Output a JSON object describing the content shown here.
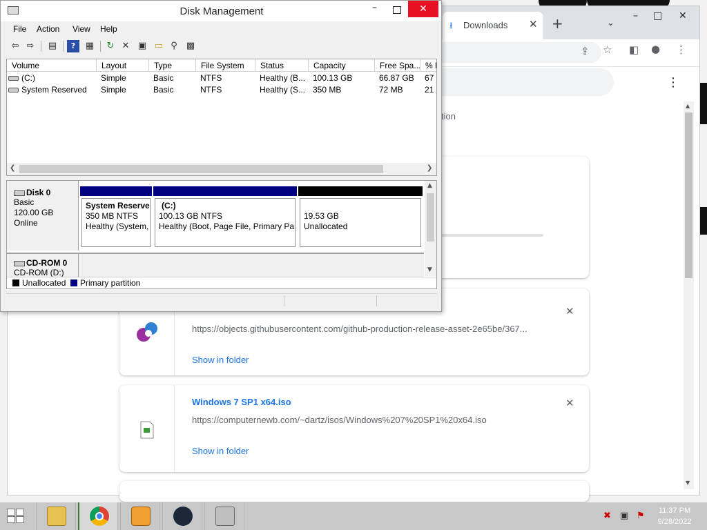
{
  "desktop": {},
  "chrome": {
    "tab": {
      "title": "Downloads",
      "icon": "download-icon"
    },
    "partial_text": "tion",
    "downloads": [
      {
        "name": "",
        "url": "https://objects.githubusercontent.com/github-production-release-asset-2e65be/367...",
        "action": "Show in folder",
        "icon": "iso-disc-icon"
      },
      {
        "name": "Windows 7 SP1 x64.iso",
        "url": "https://computernewb.com/~dartz/isos/Windows%207%20SP1%20x64.iso",
        "action": "Show in folder",
        "icon": "file-icon"
      }
    ]
  },
  "disk_management": {
    "title": "Disk Management",
    "menu": [
      "File",
      "Action",
      "View",
      "Help"
    ],
    "columns": [
      "Volume",
      "Layout",
      "Type",
      "File System",
      "Status",
      "Capacity",
      "Free Spa...",
      "% F"
    ],
    "volumes": [
      [
        "(C:)",
        "Simple",
        "Basic",
        "NTFS",
        "Healthy (B...",
        "100.13 GB",
        "66.87 GB",
        "67"
      ],
      [
        "System Reserved",
        "Simple",
        "Basic",
        "NTFS",
        "Healthy (S...",
        "350 MB",
        "72 MB",
        "21"
      ]
    ],
    "disk0": {
      "name": "Disk 0",
      "type": "Basic",
      "size": "120.00 GB",
      "state": "Online",
      "partitions": [
        {
          "name": "System Reserve",
          "size": "350 MB NTFS",
          "status": "Healthy (System,",
          "color": "#000080"
        },
        {
          "name": "(C:)",
          "size": "100.13 GB NTFS",
          "status": "Healthy (Boot, Page File, Primary Par",
          "color": "#000080"
        },
        {
          "name": "",
          "size": "19.53 GB",
          "status": "Unallocated",
          "color": "#000000"
        }
      ]
    },
    "cdrom": {
      "name": "CD-ROM 0",
      "label": "CD-ROM (D:)"
    },
    "legend": [
      {
        "label": "Unallocated",
        "color": "#000000"
      },
      {
        "label": "Primary partition",
        "color": "#000080"
      }
    ]
  },
  "taskbar": {
    "apps": [
      "file-explorer-icon",
      "chrome-icon",
      "media-player-icon",
      "steam-icon",
      "disk-management-icon"
    ],
    "time": "11:37 PM",
    "date": "9/28/2022"
  }
}
